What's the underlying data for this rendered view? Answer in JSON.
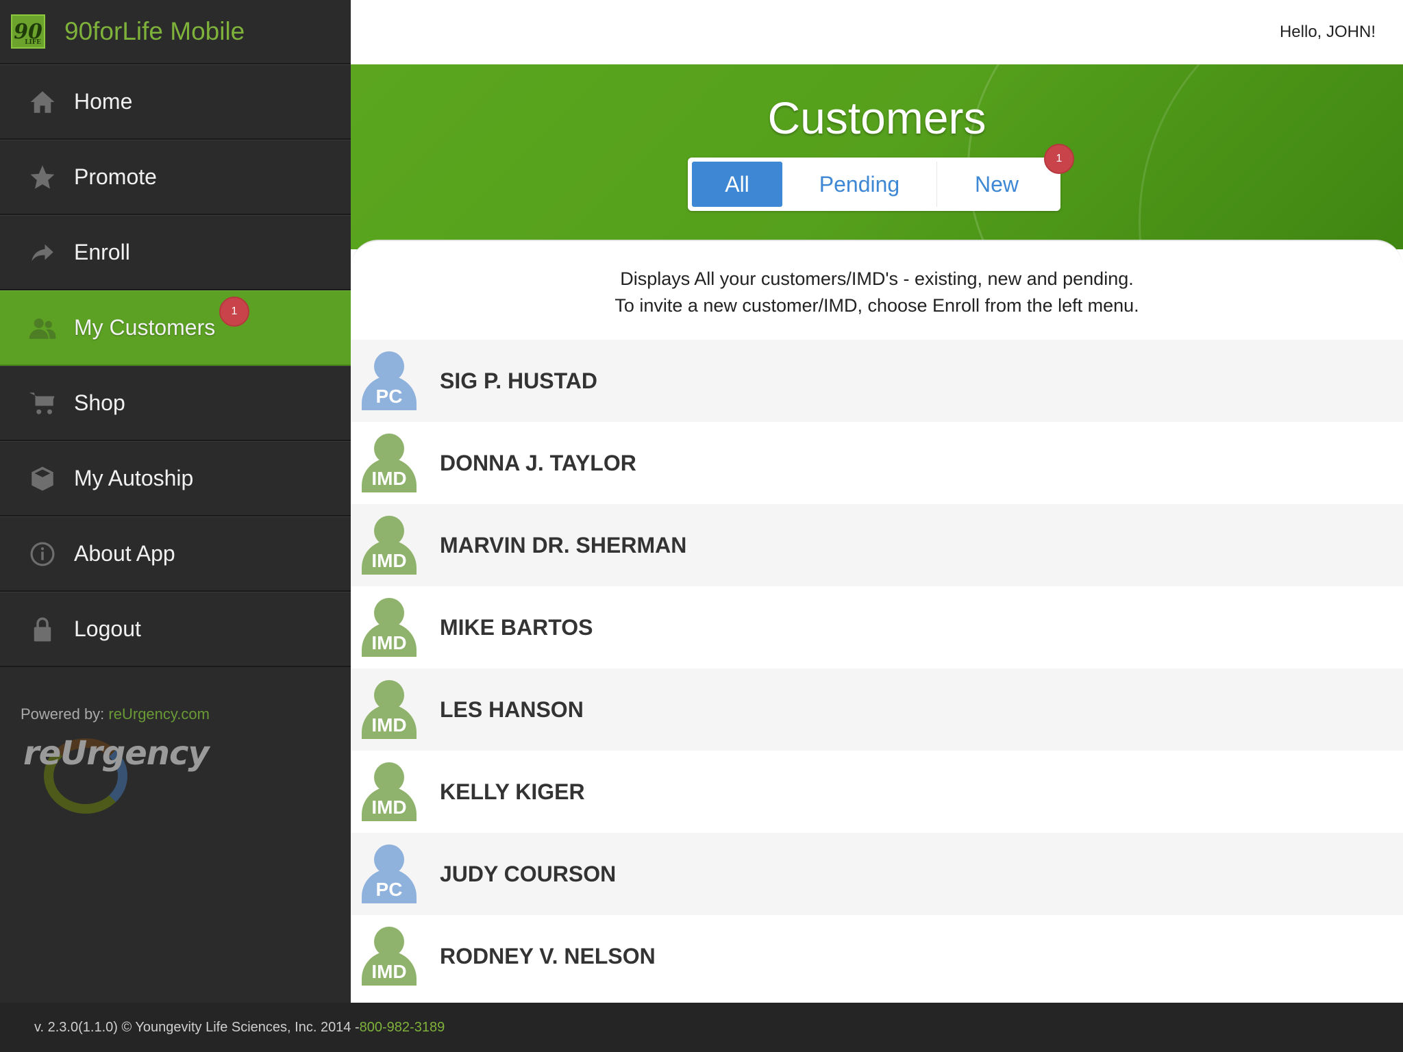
{
  "brand": {
    "logo_text": "90",
    "logo_sub": "LIFE",
    "title": "90forLife Mobile"
  },
  "header": {
    "greeting": "Hello, JOHN!"
  },
  "sidebar": {
    "items": [
      {
        "label": "Home",
        "icon": "home-icon"
      },
      {
        "label": "Promote",
        "icon": "star-icon"
      },
      {
        "label": "Enroll",
        "icon": "share-arrow-icon"
      },
      {
        "label": "My Customers",
        "icon": "people-icon",
        "active": true,
        "badge": "1"
      },
      {
        "label": "Shop",
        "icon": "cart-icon"
      },
      {
        "label": "My Autoship",
        "icon": "box-icon"
      },
      {
        "label": "About App",
        "icon": "info-icon"
      },
      {
        "label": "Logout",
        "icon": "lock-icon"
      }
    ],
    "powered_label": "Powered by:",
    "powered_link": "reUrgency.com",
    "powered_logo": "reUrgency"
  },
  "page": {
    "title": "Customers",
    "tabs": [
      {
        "label": "All",
        "selected": true
      },
      {
        "label": "Pending"
      },
      {
        "label": "New",
        "badge": "1"
      }
    ],
    "description_line1": "Displays All your customers/IMD's - existing, new and pending.",
    "description_line2": "To invite a new customer/IMD, choose Enroll from the left menu."
  },
  "customers": [
    {
      "name": "SIG P. HUSTAD",
      "type": "PC"
    },
    {
      "name": "DONNA J. TAYLOR",
      "type": "IMD"
    },
    {
      "name": "MARVIN DR. SHERMAN",
      "type": "IMD"
    },
    {
      "name": "MIKE BARTOS",
      "type": "IMD"
    },
    {
      "name": "LES HANSON",
      "type": "IMD"
    },
    {
      "name": "KELLY KIGER",
      "type": "IMD"
    },
    {
      "name": "JUDY COURSON",
      "type": "PC"
    },
    {
      "name": "RODNEY V. NELSON",
      "type": "IMD"
    }
  ],
  "footer": {
    "text": "v. 2.3.0(1.1.0) © Youngevity Life Sciences, Inc. 2014 - ",
    "phone": "800-982-3189"
  },
  "colors": {
    "accent_green": "#5ca124",
    "tab_blue": "#3d87d4",
    "badge_red": "#c9444a",
    "pc_blue": "#8fb2dd",
    "imd_green": "#8fb26c"
  }
}
